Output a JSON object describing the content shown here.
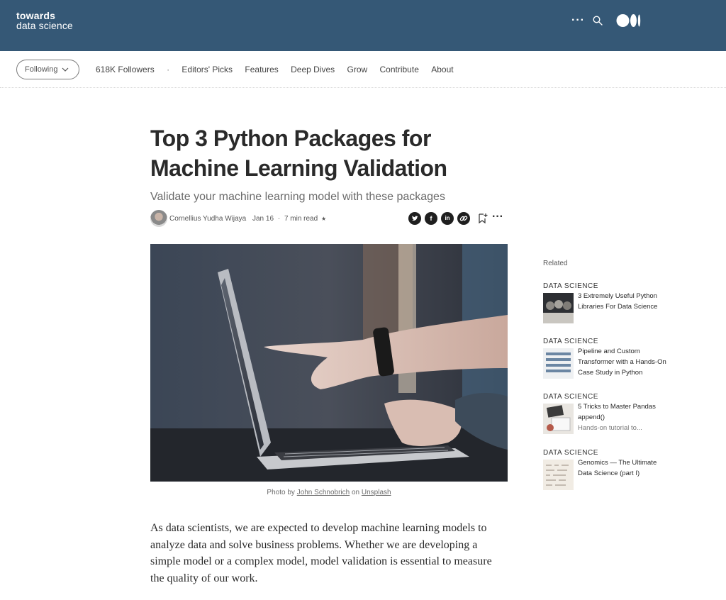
{
  "header": {
    "brand_line1": "towards",
    "brand_line2": "data science",
    "more_icon": "more-dots-icon",
    "search_icon": "search-icon",
    "logo": "medium-logo"
  },
  "subnav": {
    "follow_label": "Following",
    "followers": "618K Followers",
    "separator": "·",
    "links": [
      "Editors' Picks",
      "Features",
      "Deep Dives",
      "Grow",
      "Contribute",
      "About"
    ]
  },
  "article": {
    "title": "Top 3 Python Packages for Machine Learning Validation",
    "subtitle": "Validate your machine learning model with these packages",
    "author": "Cornellius Yudha Wijaya",
    "date": "Jan 16",
    "dot": "·",
    "read_time": "7 min read",
    "star": "★",
    "share_icons": [
      "twitter-icon",
      "facebook-icon",
      "linkedin-icon",
      "link-icon"
    ],
    "caption_prefix": "Photo by ",
    "caption_author": "John Schnobrich",
    "caption_mid": " on ",
    "caption_source": "Unsplash",
    "body": "As data scientists, we are expected to develop machine learning models to analyze data and solve business problems. Whether we are developing a simple model or a complex model, model validation is essential to measure the quality of our work."
  },
  "related": {
    "heading": "Related",
    "items": [
      {
        "tag": "DATA SCIENCE",
        "title": "3 Extremely Useful Python Libraries For Data Science",
        "subtitle": ""
      },
      {
        "tag": "DATA SCIENCE",
        "title": "Pipeline and Custom Transformer with a Hands-On Case Study in Python",
        "subtitle": ""
      },
      {
        "tag": "DATA SCIENCE",
        "title": "5 Tricks to Master Pandas append()",
        "subtitle": "Hands-on tutorial to..."
      },
      {
        "tag": "DATA SCIENCE",
        "title": "Genomics — The Ultimate Data Science (part I)",
        "subtitle": ""
      }
    ]
  },
  "colors": {
    "header_bg": "#355876",
    "text": "#292929",
    "muted": "#6b6b6b"
  }
}
